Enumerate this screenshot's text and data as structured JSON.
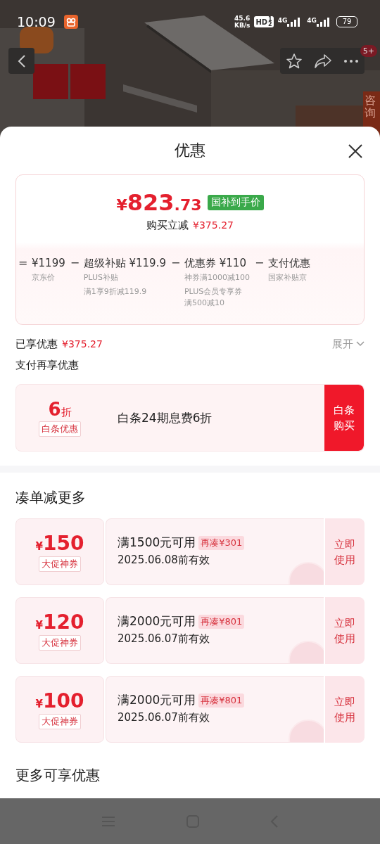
{
  "status_bar": {
    "time": "10:09",
    "speed": "45.6",
    "speed_unit": "KB/s",
    "hd": "HD",
    "hd_digits": [
      "1",
      "2"
    ],
    "signals": [
      "4G",
      "4G"
    ],
    "battery": "79"
  },
  "header": {
    "badge": "5+",
    "side_tab": "咨询"
  },
  "sheet": {
    "title": "优惠"
  },
  "price_card": {
    "currency": "¥",
    "price_int": "823",
    "price_dec": ".73",
    "tag": "国补到手价",
    "saved_label": "购买立减",
    "saved_amount": "¥375.27",
    "breakdown": [
      {
        "op": "=",
        "main": "¥1199",
        "notes": [
          "京东价"
        ]
      },
      {
        "op": "−",
        "main": "超级补贴 ¥119.9",
        "notes": [
          "PLUS补贴",
          "满1享9折减119.9"
        ]
      },
      {
        "op": "−",
        "main": "优惠券 ¥110",
        "notes": [
          "神券满1000减100",
          "PLUS会员专享券",
          "满500减10"
        ]
      },
      {
        "op": "−",
        "main": "支付优惠",
        "notes": [
          "国家补贴京"
        ]
      }
    ]
  },
  "enjoyed": {
    "label": "已享优惠",
    "amount": "¥375.27",
    "toggle": "展开"
  },
  "pay_section": {
    "title": "支付再享优惠",
    "value": "6",
    "unit": "折",
    "tag": "白条优惠",
    "desc": "白条24期息费6折",
    "button": "白条购买"
  },
  "coupon_section": {
    "title": "凑单减更多",
    "coupons": [
      {
        "currency": "¥",
        "amount": "150",
        "tag": "大促神券",
        "condition": "满1500元可用",
        "gap": "再凑¥301",
        "expiry": "2025.06.08前有效",
        "action": "立即使用"
      },
      {
        "currency": "¥",
        "amount": "120",
        "tag": "大促神券",
        "condition": "满2000元可用",
        "gap": "再凑¥801",
        "expiry": "2025.06.07前有效",
        "action": "立即使用"
      },
      {
        "currency": "¥",
        "amount": "100",
        "tag": "大促神券",
        "condition": "满2000元可用",
        "gap": "再凑¥801",
        "expiry": "2025.06.07前有效",
        "action": "立即使用"
      }
    ]
  },
  "more_section": {
    "title": "更多可享优惠"
  }
}
